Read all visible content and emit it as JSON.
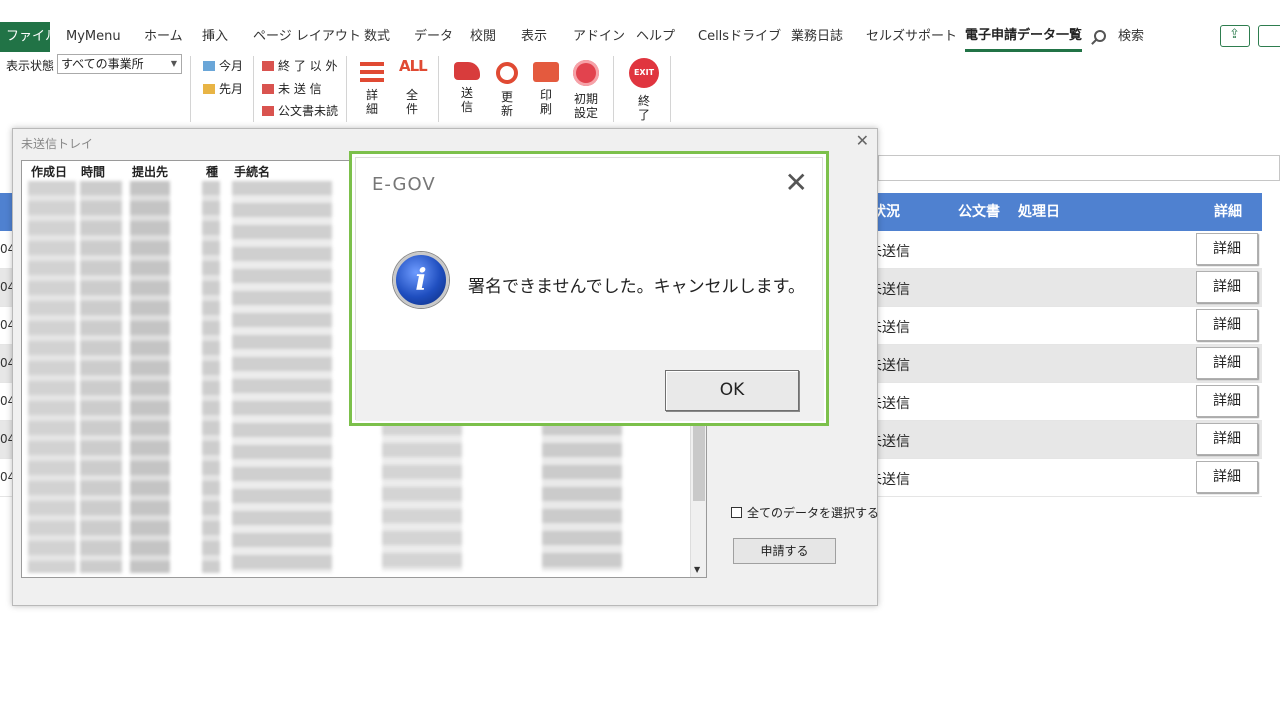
{
  "ribbon_tabs": [
    {
      "label": "ファイル"
    },
    {
      "label": "MyMenu"
    },
    {
      "label": "ホーム"
    },
    {
      "label": "挿入"
    },
    {
      "label": "ページ レイアウト"
    },
    {
      "label": "数式"
    },
    {
      "label": "データ"
    },
    {
      "label": "校閲"
    },
    {
      "label": "表示"
    },
    {
      "label": "アドイン"
    },
    {
      "label": "ヘルプ"
    },
    {
      "label": "Cellsドライブ"
    },
    {
      "label": "業務日誌"
    },
    {
      "label": "セルズサポート"
    },
    {
      "label": "電子申請データ一覧"
    },
    {
      "label": "検索"
    }
  ],
  "ribbon": {
    "status_label": "表示状態",
    "status_value": "すべての事業所",
    "this_month": "今月",
    "last_month": "先月",
    "except_done": "終 了 以 外",
    "unsent": "未 送 信",
    "unread_official": "公文書未読",
    "detail": [
      "詳",
      "細"
    ],
    "all": [
      "全",
      "件"
    ],
    "all_icon": "ALL",
    "send": [
      "送",
      "信"
    ],
    "refresh": [
      "更",
      "新"
    ],
    "print": [
      "印",
      "刷"
    ],
    "initial_settings": [
      "初期",
      "設定"
    ],
    "exit": [
      "終",
      "了"
    ],
    "exit_icon": "EXIT"
  },
  "sheet": {
    "header": {
      "status": "状況",
      "official_doc": "公文書",
      "processed_date": "処理日",
      "detail": "詳細"
    },
    "rows": [
      {
        "rownum": "04",
        "status": "未送信",
        "detail": "詳細"
      },
      {
        "rownum": "04",
        "status": "未送信",
        "detail": "詳細"
      },
      {
        "rownum": "04",
        "status": "未送信",
        "detail": "詳細"
      },
      {
        "rownum": "04",
        "status": "未送信",
        "detail": "詳細"
      },
      {
        "rownum": "04",
        "status": "未送信",
        "detail": "詳細"
      },
      {
        "rownum": "04",
        "status": "未送信",
        "detail": "詳細"
      },
      {
        "rownum": "04",
        "status": "未送信",
        "detail": "詳細"
      }
    ]
  },
  "tray": {
    "title": "未送信トレイ",
    "columns": {
      "created": "作成日",
      "time": "時間",
      "recipient": "提出先",
      "kind": "種",
      "procedure": "手続名"
    },
    "select_all": "全てのデータを選択する",
    "submit": "申請する"
  },
  "msgbox": {
    "title": "E-GOV",
    "message": "署名できませんでした。キャンセルします。",
    "ok": "OK"
  },
  "colors": {
    "excel_green": "#217346",
    "sheet_header_blue": "#4f81d0",
    "dialog_border_green": "#7cc04b",
    "icon_red": "#e04a33"
  }
}
